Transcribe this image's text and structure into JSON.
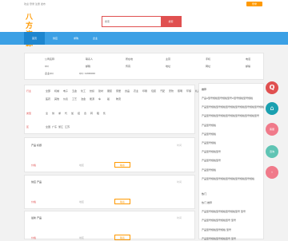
{
  "topbar": {
    "left_text": "欢迎 登录 注册 发布",
    "login_btn": "登录"
  },
  "header": {
    "logo": "八方资源",
    "search_placeholder": "搜索",
    "search_btn": "搜索"
  },
  "nav": {
    "items": [
      "首页",
      "供应",
      "求购",
      "企业"
    ]
  },
  "info": {
    "rows": [
      [
        "公司名称",
        "联系人",
        "所在地",
        "主营",
        "手机",
        "电话"
      ],
      [
        "QQ",
        "邮箱",
        "传真",
        "地址",
        "网址",
        "邮编"
      ],
      [
        "企业QQ",
        "QQ: 1206060",
        "",
        "",
        "",
        ""
      ]
    ]
  },
  "categories": [
    {
      "label": "行业",
      "options": [
        "全部",
        "机械",
        "电子",
        "五金",
        "化工",
        "纺织",
        "建材",
        "服装",
        "家居",
        "食品",
        "农业",
        "印刷",
        "包装",
        "汽配",
        "安防",
        "照明",
        "环保",
        "礼品",
        "医药",
        "其他",
        "仪表",
        "工艺",
        "冶金",
        "能源",
        "车",
        "船",
        "物流"
      ]
    },
    {
      "label": "类型",
      "options": [
        "全",
        "供",
        "求",
        "代",
        "加",
        "招",
        "合",
        "转",
        "租",
        "售"
      ]
    },
    {
      "label": "区",
      "options": [
        "全国",
        "广东",
        "浙江",
        "江苏"
      ]
    }
  ],
  "listings": [
    {
      "title": "产品 标题",
      "time": "时间",
      "price": "价格",
      "mid": "地区",
      "btn": "联系"
    },
    {
      "title": "供应 产品",
      "time": "时间",
      "price": "价格",
      "mid": "地区",
      "btn": "联系"
    },
    {
      "title": "最新 产品",
      "time": "时间",
      "price": "价格",
      "mid": "地区",
      "btn": "联系"
    }
  ],
  "sidebar": {
    "heading1": "推荐",
    "items1": [
      "产品A型号规格型号规格型号A型号规格型号规格",
      "产品型号规格型号规格型号规格型号规格型号规格型号规格",
      "产品型号规格型号规格型号规格型号规格型号规格型号",
      "产品型号规格",
      "产品型号规格",
      "产品型号规格",
      "产品型号规格型号",
      "产品型号规格型号",
      "产品型号规格",
      "产品型号规格型号规格型号规格型号规格型号规格"
    ],
    "heading2": "热门",
    "items2": [
      "热门 推荐",
      "产品型号规格型号规格型号规格型号 型号",
      "产品型号规格型号规格型号 型号",
      "产品型号规格型号规格 型号",
      "产品型号规格型号规格型号 型号"
    ]
  },
  "floating": [
    {
      "label": "Q",
      "color": "#e05050"
    },
    {
      "label": "⌂",
      "color": "#1aa0b0"
    },
    {
      "label": "客服",
      "color": "#f07a8a"
    },
    {
      "label": "咨询",
      "color": "#5fc4b4"
    },
    {
      "label": "↑",
      "color": "#f07a8a"
    }
  ]
}
